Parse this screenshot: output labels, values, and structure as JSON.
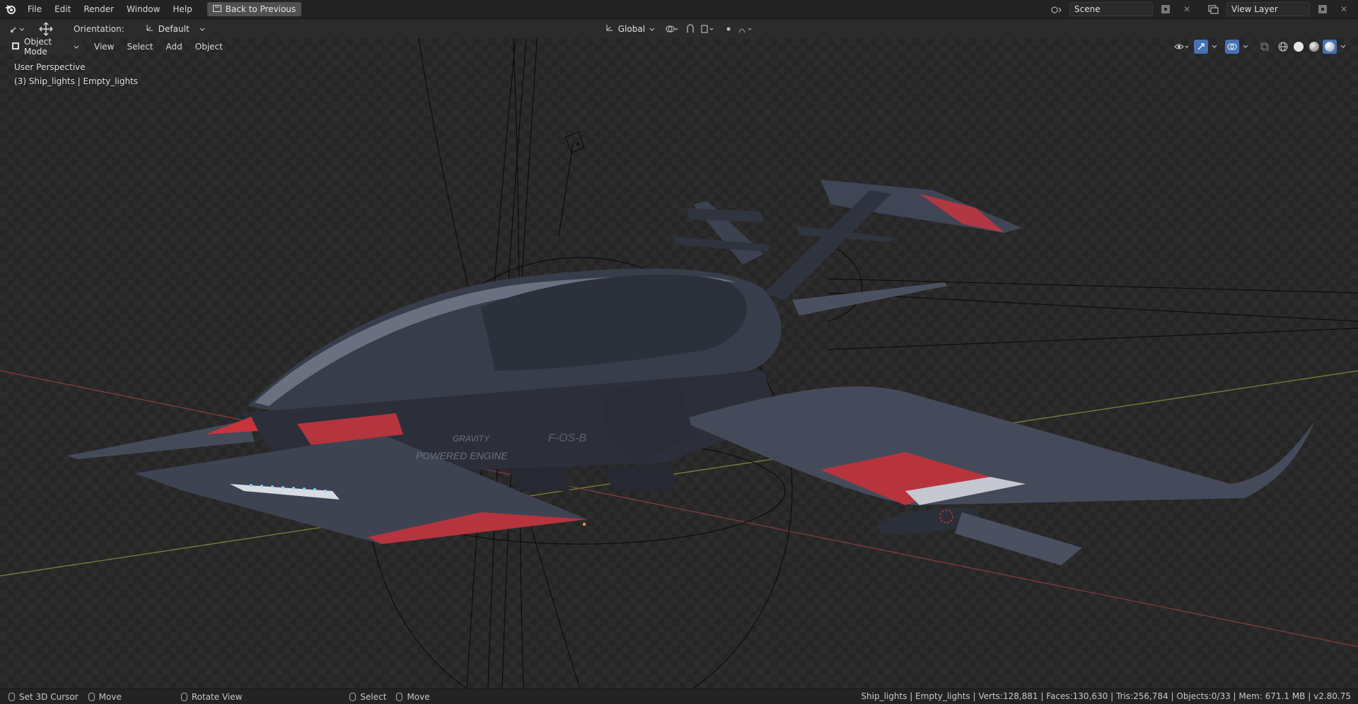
{
  "topbar": {
    "menu": [
      "File",
      "Edit",
      "Render",
      "Window",
      "Help"
    ],
    "back_label": "Back to Previous",
    "scene": "Scene",
    "view_layer": "View Layer"
  },
  "toolbar": {
    "orientation_label": "Orientation:",
    "orientation_value": "Default",
    "transform_space": "Global"
  },
  "viewport_header": {
    "mode": "Object Mode",
    "menu": [
      "View",
      "Select",
      "Add",
      "Object"
    ]
  },
  "viewport": {
    "perspective": "User Perspective",
    "active_object": "(3) Ship_lights | Empty_lights",
    "decal_line1": "GRAVITY",
    "decal_line2": "POWERED ENGINE",
    "decal_code": "F-OS-B"
  },
  "statusbar": {
    "hint1": "Set 3D Cursor",
    "hint2": "Move",
    "hint3": "Rotate View",
    "hint4": "Select",
    "hint5": "Move",
    "stats": "Ship_lights | Empty_lights | Verts:128,881 | Faces:130,630 | Tris:256,784 | Objects:0/33 | Mem: 671.1 MB | v2.80.75"
  },
  "colors": {
    "accent": "#4772b3",
    "ship_body": "#3a3f4e",
    "ship_stripe": "#c8343c"
  },
  "icons": [
    "blender-logo-icon",
    "editor-type-icon",
    "transform-gizmo-icon",
    "global-axis-icon",
    "pivot-icon",
    "snap-icon",
    "proportional-icon",
    "visibility-icon",
    "gizmo-icon",
    "overlay-icon",
    "xray-icon",
    "wireframe-shading-icon",
    "solid-shading-icon",
    "material-shading-icon",
    "rendered-shading-icon",
    "scene-icon",
    "view-layer-icon",
    "new-icon",
    "close-icon",
    "mouse-icon"
  ]
}
